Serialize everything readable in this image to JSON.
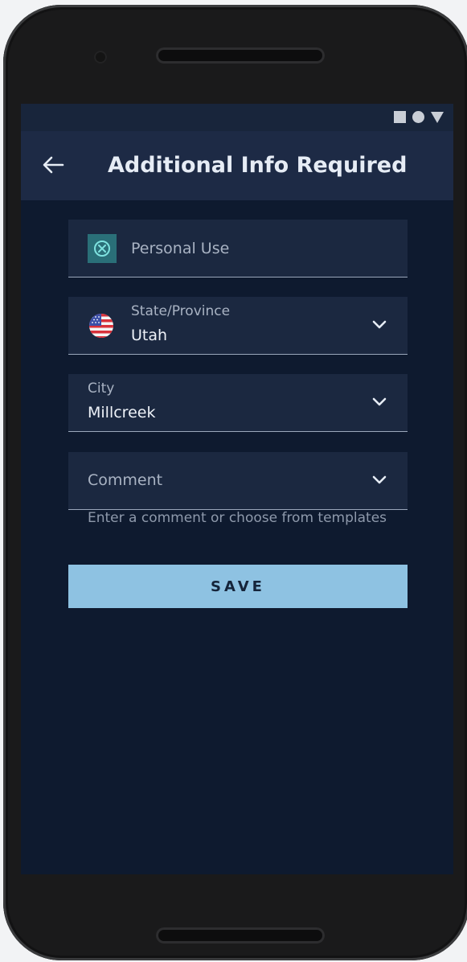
{
  "status_bar": {
    "icons": [
      "square-icon",
      "circle-icon",
      "triangle-icon"
    ]
  },
  "header": {
    "title": "Additional Info Required",
    "back_icon": "arrow-left-icon"
  },
  "form": {
    "usage": {
      "label": "Personal Use",
      "icon": "cancel-circle-icon"
    },
    "state": {
      "label": "State/Province",
      "value": "Utah",
      "icon": "us-flag-icon"
    },
    "city": {
      "label": "City",
      "value": "Millcreek"
    },
    "comment": {
      "placeholder": "Comment",
      "helper": "Enter a comment or choose from templates"
    },
    "save_label": "SAVE"
  },
  "colors": {
    "screen_bg": "#0e1a2f",
    "app_bar": "#1d2a45",
    "field_bg": "#1b2840",
    "accent_button": "#8ec2e2",
    "usage_icon_bg": "#2a6f78"
  }
}
